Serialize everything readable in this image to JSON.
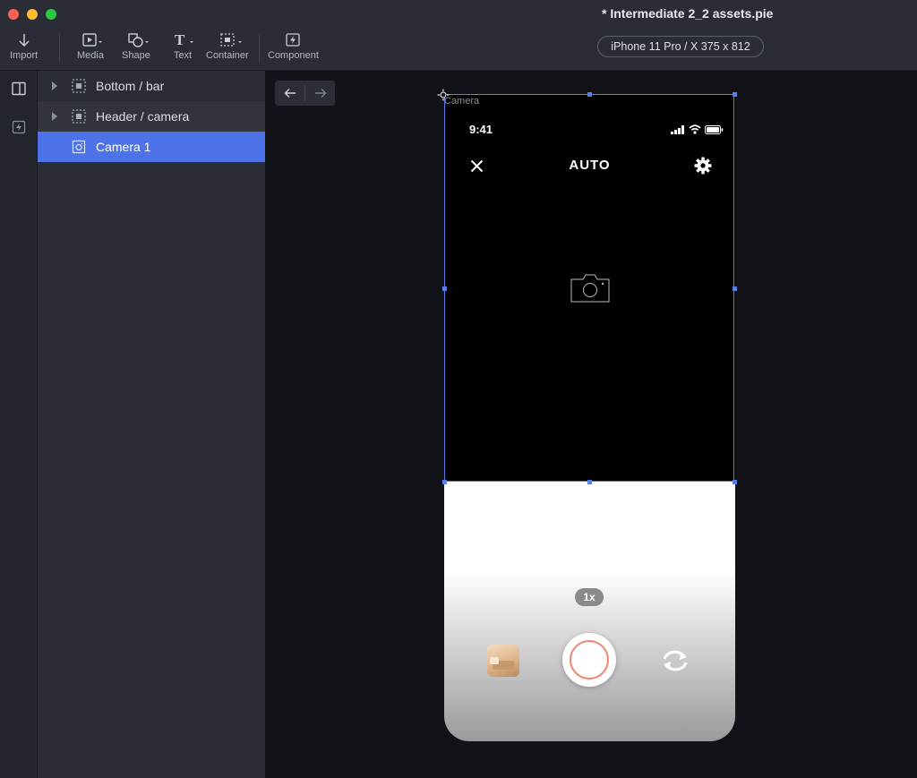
{
  "window": {
    "title": "* Intermediate 2_2 assets.pie",
    "traffic_lights": {
      "close": "#fe5f57",
      "minimize": "#febc2e",
      "maximize": "#28c840"
    }
  },
  "toolbar": {
    "import": "Import",
    "media": "Media",
    "shape": "Shape",
    "text": "Text",
    "text_glyph": "T",
    "container": "Container",
    "component": "Component",
    "device": "iPhone 11 Pro / X  375 x 812"
  },
  "layers": [
    {
      "label": "Bottom / bar",
      "icon": "container-icon",
      "expandable": true
    },
    {
      "label": "Header / camera",
      "icon": "container-icon",
      "expandable": true
    },
    {
      "label": "Camera 1",
      "icon": "image-icon",
      "selected": true
    }
  ],
  "canvas": {
    "frame_label": "Camera",
    "accent": "#5a7ee8",
    "phone": {
      "status_time": "9:41",
      "mode_label": "AUTO",
      "zoom_label": "1x",
      "shutter_ring_color": "#f2866a"
    }
  }
}
